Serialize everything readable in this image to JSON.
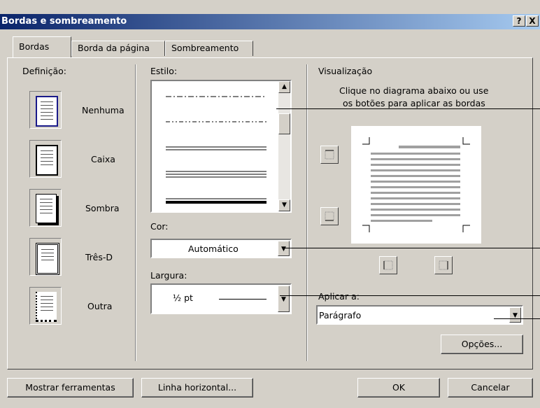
{
  "dialog": {
    "title": "Bordas e sombreamento",
    "help_label": "?",
    "close_label": "X"
  },
  "tabs": [
    {
      "label": "Bordas",
      "active": true
    },
    {
      "label": "Borda da página",
      "active": false
    },
    {
      "label": "Sombreamento",
      "active": false
    }
  ],
  "definicao": {
    "label": "Definição:",
    "items": [
      {
        "label": "Nenhuma"
      },
      {
        "label": "Caixa"
      },
      {
        "label": "Sombra"
      },
      {
        "label": "Três-D"
      },
      {
        "label": "Outra"
      }
    ]
  },
  "estilo": {
    "label": "Estilo:"
  },
  "cor": {
    "label": "Cor:",
    "value": "Automático"
  },
  "largura": {
    "label": "Largura:",
    "value": "½ pt"
  },
  "visualizacao": {
    "label": "Visualização",
    "hint_line1": "Clique no diagrama abaixo ou use",
    "hint_line2": "os botões para aplicar as bordas"
  },
  "aplicar": {
    "label": "Aplicar a:",
    "value": "Parágrafo"
  },
  "buttons": {
    "opcoes": "Opções...",
    "mostrar": "Mostrar ferramentas",
    "linha": "Linha horizontal...",
    "ok": "OK",
    "cancelar": "Cancelar"
  }
}
